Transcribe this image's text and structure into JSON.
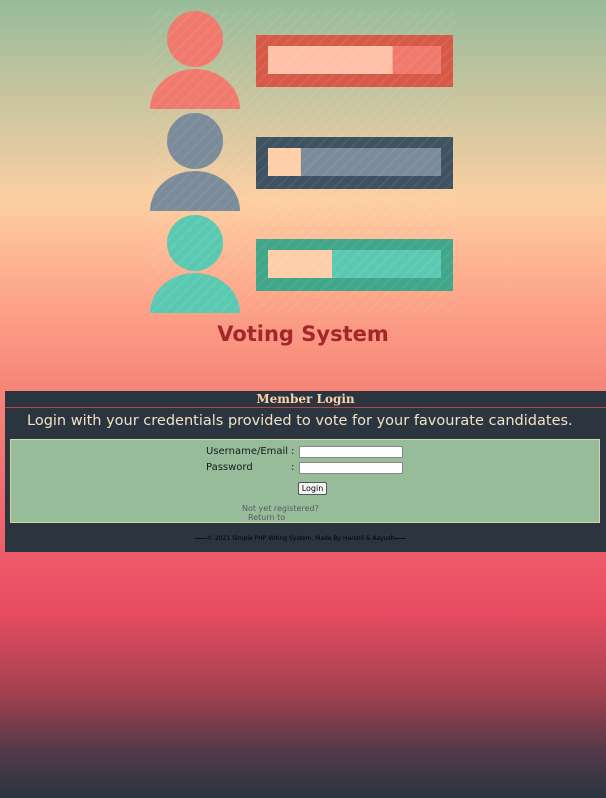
{
  "app": {
    "title": "Voting System"
  },
  "colors": {
    "title": "#a2262a",
    "panel_head_text": "#fcd2a8",
    "intro_text": "#f4e1c6",
    "form_bg": "#97bc9a",
    "candidate_red": "#f17a6e",
    "candidate_red_frame": "#d75a48",
    "candidate_gray": "#7b8b9a",
    "candidate_gray_frame": "#3e5262",
    "candidate_teal": "#5bc9b1",
    "candidate_teal_frame": "#41a68a"
  },
  "candidates": [
    {
      "name": "red-candidate",
      "vote_share": 0.28
    },
    {
      "name": "gray-candidate",
      "vote_share": 0.81
    },
    {
      "name": "teal-candidate",
      "vote_share": 0.63
    }
  ],
  "login": {
    "heading": "Member Login",
    "intro": "Login with your credentials provided to vote for your favourate candidates.",
    "username_label": "Username/Email",
    "password_label": "Password",
    "colon": ":",
    "username_value": "",
    "password_value": "",
    "login_button": "Login",
    "register_text": "Not yet registered?",
    "return_text": "Return to"
  },
  "footer": {
    "copyright": "© 2021 Simple PHP Voting System. Made By Harshil & Aayush"
  }
}
